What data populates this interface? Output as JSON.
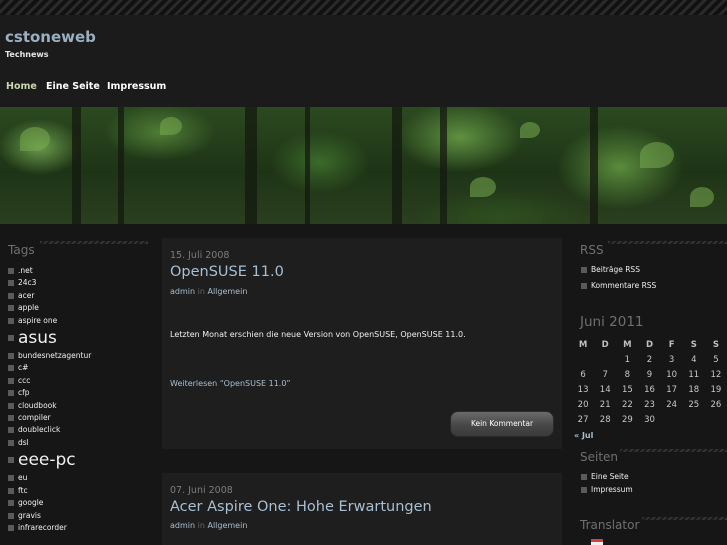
{
  "site": {
    "title": "cstoneweb",
    "description": "Technews"
  },
  "nav": {
    "items": [
      "Home",
      "Eine Seite",
      "Impressum"
    ]
  },
  "sidebar_left": {
    "title": "Tags",
    "tags": [
      ".net",
      "24c3",
      "acer",
      "apple",
      "aspire one",
      "asus",
      "bundesnetzagentur",
      "c#",
      "ccc",
      "cfp",
      "cloudbook",
      "compiler",
      "doubleclick",
      "dsl",
      "eee-pc",
      "eu",
      "ftc",
      "google",
      "gravis",
      "infrarecorder"
    ]
  },
  "posts": [
    {
      "date": "15. Juli 2008",
      "title": "OpenSUSE 11.0",
      "author": "admin",
      "in_label": "in",
      "category": "Allgemein",
      "body": "Letzten Monat erschien die neue Version von OpenSUSE, OpenSUSE 11.0.",
      "readmore": "Weiterlesen “OpenSUSE 11.0”",
      "comment_button": "Kein Kommentar"
    },
    {
      "date": "07. Juni 2008",
      "title": "Acer Aspire One: Hohe Erwartungen",
      "author": "admin",
      "in_label": "in",
      "category": "Allgemein"
    }
  ],
  "rss": {
    "title": "RSS",
    "links": [
      "Beiträge RSS",
      "Kommentare RSS"
    ]
  },
  "calendar": {
    "title": "Juni 2011",
    "weekdays": [
      "M",
      "D",
      "M",
      "D",
      "F",
      "S",
      "S"
    ],
    "weeks": [
      [
        "",
        "",
        "1",
        "2",
        "3",
        "4",
        "5"
      ],
      [
        "6",
        "7",
        "8",
        "9",
        "10",
        "11",
        "12"
      ],
      [
        "13",
        "14",
        "15",
        "16",
        "17",
        "18",
        "19"
      ],
      [
        "20",
        "21",
        "22",
        "23",
        "24",
        "25",
        "26"
      ],
      [
        "27",
        "28",
        "29",
        "30",
        "",
        "",
        ""
      ]
    ],
    "prev": "« Jul"
  },
  "pages": {
    "title": "Seiten",
    "links": [
      "Eine Seite",
      "Impressum"
    ]
  },
  "translator": {
    "title": "Translator"
  }
}
